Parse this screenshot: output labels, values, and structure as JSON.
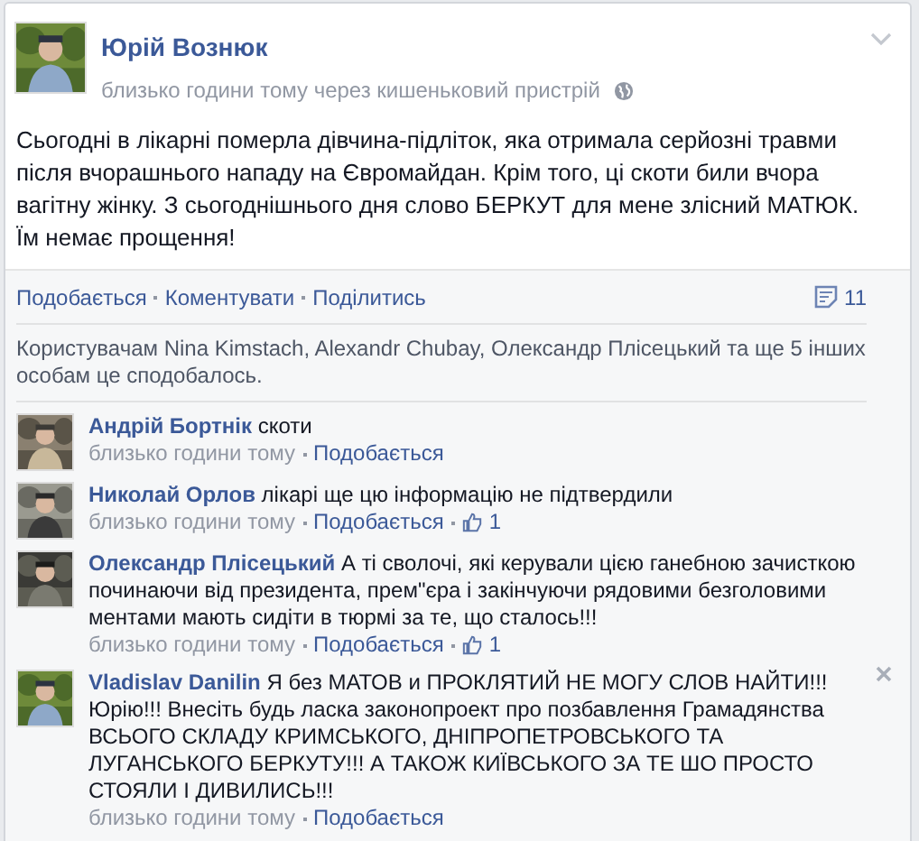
{
  "post": {
    "author": "Юрій Вознюк",
    "meta": "близько години тому через кишеньковий пристрій",
    "text": "Сьогодні в лікарні померла дівчина-підліток, яка отримала серйозні травми після вчорашнього нападу на Євромайдан. Крім того, ці скоти били вчора вагітну жінку. З сьогоднішнього дня слово БЕРКУТ для мене злісний МАТЮК. Їм немає прощення!",
    "actions": [
      "Подобається",
      "Коментувати",
      "Поділитись"
    ],
    "comment_count": "11",
    "likes_summary": "Користувачам Nina Kimstach, Alexandr Chubay, Олександр Плісецький та ще 5 інших особам це сподобалось."
  },
  "comments": [
    {
      "author": "Андрій Бортнік",
      "text": "скоти",
      "time": "близько години тому",
      "like_label": "Подобається",
      "hovered": false
    },
    {
      "author": "Николай Орлов",
      "text": "лікарі ще цю інформацію не підтвердили",
      "time": "близько години тому",
      "like_label": "Подобається",
      "likes": "1",
      "hovered": false
    },
    {
      "author": "Олександр Плісецький",
      "text": "А ті сволочі, які керували цією ганебною зачисткою починаючи від президента, прем\"єра і закінчуючи рядовими безголовими ментами мають сидіти в тюрмі за те, що сталось!!!",
      "time": "близько години тому",
      "like_label": "Подобається",
      "likes": "1",
      "hovered": false
    },
    {
      "author": "Vladislav Danilin",
      "text": "Я без МАТОВ и ПРОКЛЯТИЙ НЕ МОГУ СЛОВ НАЙТИ!!! Юрію!!! Внесіть будь ласка законопроект про позбавлення Грамадянства ВСЬОГО СКЛАДУ КРИМСЬКОГО, ДНІПРОПЕТРОВСЬКОГО ТА ЛУГАНСЬКОГО БЕРКУТУ!!! А ТАКОЖ КИЇВСЬКОГО ЗА ТЕ ШО ПРОСТО СТОЯЛИ І ДИВИЛИСЬ!!!",
      "time": "близько години тому",
      "like_label": "Подобається",
      "hovered": true
    }
  ]
}
